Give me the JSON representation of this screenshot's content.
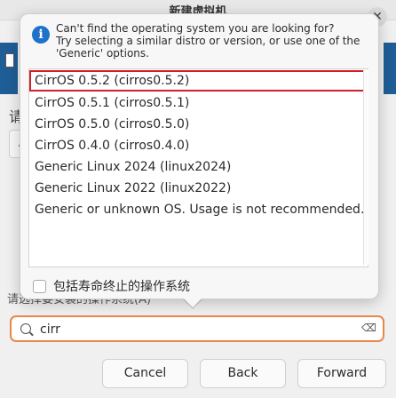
{
  "background": {
    "title": "新建虚拟机",
    "char_label": "请",
    "field_char": "/",
    "faded_label": "请选择要安装的操作系统(A)"
  },
  "popover": {
    "info_icon": "info-icon",
    "info_lines": [
      "Can't find the operating system you are looking for?",
      "Try selecting a similar distro or version, or use one of the",
      "'Generic' options."
    ],
    "os_list": [
      "CirrOS 0.5.2 (cirros0.5.2)",
      "CirrOS 0.5.1 (cirros0.5.1)",
      "CirrOS 0.5.0 (cirros0.5.0)",
      "CirrOS 0.4.0 (cirros0.4.0)",
      "Generic Linux 2024 (linux2024)",
      "Generic Linux 2022 (linux2022)",
      "Generic or unknown OS. Usage is not recommended. (generic)"
    ],
    "selected_index": 0,
    "include_eol_label": "包括寿命终止的操作系统",
    "include_eol_checked": false
  },
  "search": {
    "value": "cirr",
    "placeholder": ""
  },
  "buttons": {
    "cancel": "Cancel",
    "back": "Back",
    "forward": "Forward"
  },
  "colors": {
    "selection_outline": "#d0202a",
    "search_focus": "#e9864b",
    "info_blue": "#1f72c9"
  }
}
